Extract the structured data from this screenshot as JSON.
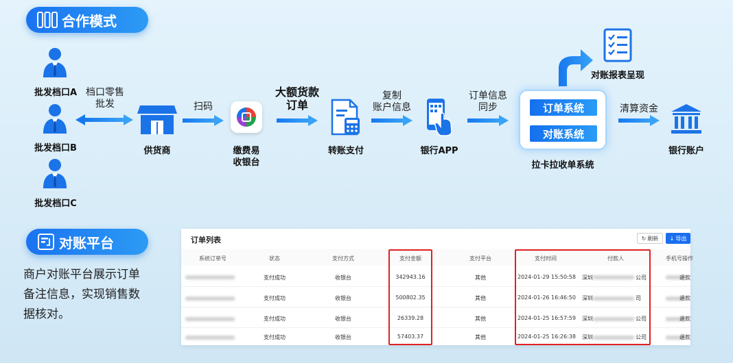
{
  "section1": {
    "title": "合作模式"
  },
  "section2": {
    "title": "对账平台",
    "description": "商户对账平台展示订单备注信息，实现销售数据核对。"
  },
  "wholesalers": [
    "批发档口A",
    "批发档口B",
    "批发档口C"
  ],
  "flow": {
    "retail_label_1": "档口零售",
    "retail_label_2": "批发",
    "supplier": "供货商",
    "scan": "扫码",
    "cashier_1": "缴费易",
    "cashier_2": "收银台",
    "bulk_1": "大额货款",
    "bulk_2": "订单",
    "transfer": "转账支付",
    "copy_1": "复制",
    "copy_2": "账户信息",
    "bank_app": "银行APP",
    "sync_1": "订单信息",
    "sync_2": "同步",
    "order_system": "订单系统",
    "recon_system": "对账系统",
    "lakala": "拉卡拉收单系统",
    "report": "对账报表呈现",
    "clearing": "清算资金",
    "bank_account": "银行账户"
  },
  "table": {
    "title": "订单列表",
    "refresh": "刷新",
    "export": "导出",
    "headers": [
      "系统订单号",
      "状态",
      "支付方式",
      "支付金额",
      "支付平台",
      "支付时间",
      "付款人",
      "手机号",
      "操作"
    ],
    "rows": [
      {
        "status": "支付成功",
        "method": "收银台",
        "amount": "342943.16",
        "platform": "其他",
        "time": "2024-01-29 15:50:58",
        "payer_prefix": "深圳",
        "payer_suffix": "公司",
        "action": "退款"
      },
      {
        "status": "支付成功",
        "method": "收银台",
        "amount": "500802.35",
        "platform": "其他",
        "time": "2024-01-26 16:46:50",
        "payer_prefix": "深圳",
        "payer_suffix": "司",
        "action": "退款"
      },
      {
        "status": "支付成功",
        "method": "收银台",
        "amount": "26339.28",
        "platform": "其他",
        "time": "2024-01-25 16:57:59",
        "payer_prefix": "深圳",
        "payer_suffix": "公司",
        "action": "退款"
      },
      {
        "status": "支付成功",
        "method": "收银台",
        "amount": "57403.37",
        "platform": "其他",
        "time": "2024-01-25 16:26:38",
        "payer_prefix": "深圳",
        "payer_suffix": "公司",
        "action": "退款"
      }
    ]
  },
  "colors": {
    "accent": "#1a73f0",
    "highlight": "#e02020"
  }
}
